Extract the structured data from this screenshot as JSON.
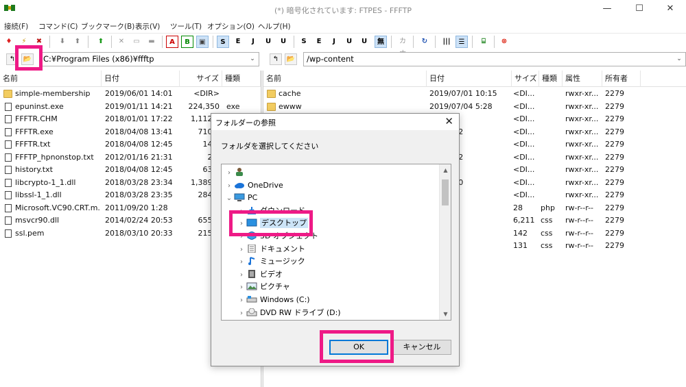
{
  "window": {
    "title": "(*) 暗号化されています: FTPES - FFFTP",
    "minimize": "—",
    "maximize": "☐",
    "close": "✕"
  },
  "menu": [
    "接続(F)",
    "コマンド(C)",
    "ブックマーク(B)",
    "表示(V)",
    "ツール(T)",
    "オプション(O)",
    "ヘルプ(H)"
  ],
  "toolbar": {
    "ascii_tool_label": "A",
    "binary_tool_label": "B",
    "kanji_label": "無",
    "kana_label": "カナ"
  },
  "local": {
    "path": "C:¥Program Files (x86)¥ffftp",
    "columns": [
      "名前",
      "日付",
      "サイズ",
      "種類"
    ],
    "rows": [
      {
        "icon": "folder",
        "name": "simple-membership",
        "date": "2019/06/01 14:01",
        "size": "<DIR>",
        "type": ""
      },
      {
        "icon": "file",
        "name": "epuninst.exe",
        "date": "2019/01/11 14:21",
        "size": "224,350",
        "type": "exe"
      },
      {
        "icon": "file",
        "name": "FFFTR.CHM",
        "date": "2018/01/01 17:22",
        "size": "1,112,0",
        "type": ""
      },
      {
        "icon": "file",
        "name": "FFFTR.exe",
        "date": "2018/04/08 13:41",
        "size": "710,6",
        "type": ""
      },
      {
        "icon": "file",
        "name": "FFFTR.txt",
        "date": "2018/04/08 12:45",
        "size": "14,2",
        "type": ""
      },
      {
        "icon": "file",
        "name": "FFFTP_hpnonstop.txt",
        "date": "2012/01/16 21:31",
        "size": "2,3",
        "type": ""
      },
      {
        "icon": "file",
        "name": "history.txt",
        "date": "2018/04/08 12:45",
        "size": "63,8",
        "type": ""
      },
      {
        "icon": "file",
        "name": "libcrypto-1_1.dll",
        "date": "2018/03/28 23:34",
        "size": "1,389,5",
        "type": ""
      },
      {
        "icon": "file",
        "name": "libssl-1_1.dll",
        "date": "2018/03/28 23:35",
        "size": "284,1",
        "type": ""
      },
      {
        "icon": "file",
        "name": "Microsoft.VC90.CRT.m...",
        "date": "2011/09/20 1:28",
        "size": "3",
        "type": ""
      },
      {
        "icon": "file",
        "name": "msvcr90.dll",
        "date": "2014/02/24 20:53",
        "size": "655,8",
        "type": ""
      },
      {
        "icon": "file",
        "name": "ssl.pem",
        "date": "2018/03/10 20:33",
        "size": "215,5",
        "type": ""
      }
    ]
  },
  "remote": {
    "path": "/wp-content",
    "columns": [
      "名前",
      "日付",
      "サイズ",
      "種類",
      "属性",
      "所有者"
    ],
    "rows": [
      {
        "icon": "folder",
        "name": "cache",
        "date": "2019/07/01 10:15",
        "size": "<DI...",
        "type": "",
        "attr": "rwxr-xr...",
        "owner": "2279"
      },
      {
        "icon": "folder",
        "name": "ewww",
        "date": "2019/07/04 5:28",
        "size": "<DI...",
        "type": "",
        "attr": "rwxr-xr...",
        "owner": "2279"
      },
      {
        "icon": "folder",
        "name": "",
        "date": "25 1:23",
        "size": "<DI...",
        "type": "",
        "attr": "rwxr-xr...",
        "owner": "2279"
      },
      {
        "icon": "folder",
        "name": "",
        "date": "06 16:32",
        "size": "<DI...",
        "type": "",
        "attr": "rwxr-xr...",
        "owner": "2279"
      },
      {
        "icon": "folder",
        "name": "",
        "date": "30 5:14",
        "size": "<DI...",
        "type": "",
        "attr": "rwxr-xr...",
        "owner": "2279"
      },
      {
        "icon": "folder",
        "name": "",
        "date": "08 14:02",
        "size": "<DI...",
        "type": "",
        "attr": "rwxr-xr...",
        "owner": "2279"
      },
      {
        "icon": "folder",
        "name": "",
        "date": "26 5:23",
        "size": "<DI...",
        "type": "",
        "attr": "rwxr-xr...",
        "owner": "2279"
      },
      {
        "icon": "folder",
        "name": "",
        "date": "01 10:20",
        "size": "<DI...",
        "type": "",
        "attr": "rwxr-xr...",
        "owner": "2279"
      },
      {
        "icon": "folder",
        "name": "",
        "date": "30 9:24",
        "size": "<DI...",
        "type": "",
        "attr": "rwxr-xr...",
        "owner": "2279"
      },
      {
        "icon": "file",
        "name": "",
        "date": "09 2:01",
        "size": "28",
        "type": "php",
        "attr": "rw-r--r--",
        "owner": "2279"
      },
      {
        "icon": "file",
        "name": "",
        "date": "23 7:28",
        "size": "6,211",
        "type": "css",
        "attr": "rw-r--r--",
        "owner": "2279"
      },
      {
        "icon": "file",
        "name": "",
        "date": "23 7:28",
        "size": "142",
        "type": "css",
        "attr": "rw-r--r--",
        "owner": "2279"
      },
      {
        "icon": "file",
        "name": "",
        "date": "23 7:28",
        "size": "131",
        "type": "css",
        "attr": "rw-r--r--",
        "owner": "2279"
      }
    ]
  },
  "dialog": {
    "title": "フォルダーの参照",
    "close": "✕",
    "prompt": "フォルダを選択してください",
    "tree": [
      {
        "label": "",
        "icon": "user",
        "chevron": "›",
        "level": 0
      },
      {
        "label": "OneDrive",
        "icon": "cloud",
        "chevron": "›",
        "level": 0
      },
      {
        "label": "PC",
        "icon": "pc",
        "chevron": "⌄",
        "level": 0
      },
      {
        "label": "ダウンロード",
        "icon": "download",
        "chevron": "›",
        "level": 1
      },
      {
        "label": "デスクトップ",
        "icon": "desktop",
        "chevron": "›",
        "level": 1,
        "selected": true
      },
      {
        "label": "3D オブジェクト",
        "icon": "cube",
        "chevron": "›",
        "level": 1
      },
      {
        "label": "ドキュメント",
        "icon": "document",
        "chevron": "›",
        "level": 1
      },
      {
        "label": "ミュージック",
        "icon": "music",
        "chevron": "›",
        "level": 1
      },
      {
        "label": "ビデオ",
        "icon": "video",
        "chevron": "›",
        "level": 1
      },
      {
        "label": "ピクチャ",
        "icon": "picture",
        "chevron": "›",
        "level": 1
      },
      {
        "label": "Windows (C:)",
        "icon": "drive",
        "chevron": "›",
        "level": 1
      },
      {
        "label": "DVD RW ドライブ (D:)",
        "icon": "dvd",
        "chevron": "›",
        "level": 1
      }
    ],
    "ok_label": "OK",
    "cancel_label": "キャンセル"
  },
  "colors": {
    "highlight": "#ee1a86",
    "selection": "#cce4f7",
    "default_button": "#0078d7"
  }
}
